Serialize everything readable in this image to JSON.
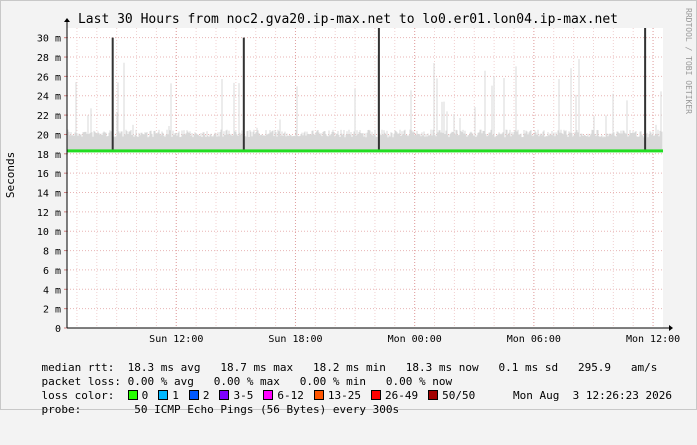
{
  "chart_data": {
    "type": "line",
    "title": "Last 30 Hours from noc2.gva20.ip-max.net to lo0.er01.lon04.ip-max.net",
    "ylabel": "Seconds",
    "side_label": "RRDTOOL / TOBI OETIKER",
    "ylim": [
      0,
      31
    ],
    "y_ticks": [
      0,
      2,
      4,
      6,
      8,
      10,
      12,
      14,
      16,
      18,
      20,
      22,
      24,
      26,
      28,
      30
    ],
    "y_tick_labels": [
      "0",
      "2 m",
      "4 m",
      "6 m",
      "8 m",
      "10 m",
      "12 m",
      "14 m",
      "16 m",
      "18 m",
      "20 m",
      "22 m",
      "24 m",
      "26 m",
      "28 m",
      "30 m"
    ],
    "x_axis": {
      "start": "Sun 06:30",
      "end": "Mon 12:30",
      "hours_span": 30,
      "tick_labels": [
        "Sun 12:00",
        "Sun 18:00",
        "Mon 00:00",
        "Mon 06:00",
        "Mon 12:00"
      ],
      "tick_hours": [
        5.5,
        11.5,
        17.5,
        23.5,
        29.5
      ]
    },
    "grid": true,
    "series": [
      {
        "legend": "median rtt",
        "color": "#22dd22",
        "values_ms": {
          "avg": 18.3,
          "max": 18.7,
          "min": 18.2,
          "now": 18.3
        }
      }
    ],
    "noise_band_ms": [
      18.2,
      20.5
    ],
    "spikes": [
      {
        "hour": 2.3,
        "value_ms": 30.0
      },
      {
        "hour": 8.9,
        "value_ms": 30.0
      },
      {
        "hour": 15.7,
        "value_ms": 31.0
      },
      {
        "hour": 29.1,
        "value_ms": 31.0
      }
    ]
  },
  "stats": {
    "median_label": "median rtt:",
    "median_text": "18.3 ms avg   18.7 ms max   18.2 ms min   18.3 ms now   0.1 ms sd   295.9   am/s",
    "loss_label": "packet loss:",
    "loss_text": "0.00 % avg   0.00 % max   0.00 % min   0.00 % now",
    "color_label": "loss color:",
    "probe_label": "probe:",
    "probe_text": "50 ICMP Echo Pings (56 Bytes) every 300s",
    "timestamp": "Mon Aug  3 12:26:23 2026"
  },
  "loss_colors": [
    {
      "label": "0",
      "color": "#26ff00"
    },
    {
      "label": "1",
      "color": "#00b8ff"
    },
    {
      "label": "2",
      "color": "#0059ff"
    },
    {
      "label": "3-5",
      "color": "#7e00ff"
    },
    {
      "label": "6-12",
      "color": "#ff00ff"
    },
    {
      "label": "13-25",
      "color": "#ff5500"
    },
    {
      "label": "26-49",
      "color": "#ff0000"
    },
    {
      "label": "50/50",
      "color": "#a10000"
    }
  ]
}
